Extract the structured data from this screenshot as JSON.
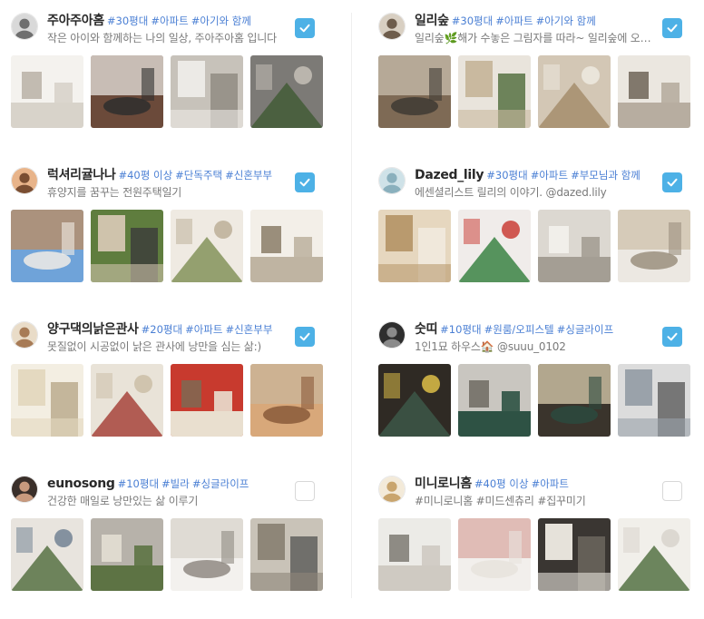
{
  "columns": [
    [
      {
        "name": "주아주아홈",
        "tags": [
          "#30평대",
          "#아파트",
          "#아기와 함께"
        ],
        "desc": "작은 아이와 함께하는 나의 일상, 주아주아홈 입니다",
        "checked": true,
        "avatar": [
          "#d9d9d9",
          "#6f6f6f"
        ],
        "photos": [
          [
            "#f4f2ee",
            "#d8d3ca",
            "#b9b2a6"
          ],
          [
            "#6b4a3a",
            "#f0eeea",
            "#2e2e2e"
          ],
          [
            "#c7c2ba",
            "#eceae6",
            "#8d8880"
          ],
          [
            "#7c7a76",
            "#3f5a33",
            "#c9c4bc"
          ]
        ]
      },
      {
        "name": "럭셔리귤나나",
        "tags": [
          "#40평 이상",
          "#단독주택",
          "#신혼부부"
        ],
        "desc": "휴양지를 꿈꾸는 전원주택일기",
        "checked": true,
        "avatar": [
          "#e8b48a",
          "#7a4e32"
        ],
        "photos": [
          [
            "#6fa3d9",
            "#c58a55",
            "#f1ece5"
          ],
          [
            "#5f7d3e",
            "#cfc3ac",
            "#3b3b3b"
          ],
          [
            "#efeae2",
            "#7d8d52",
            "#b9ab94"
          ],
          [
            "#f3efe8",
            "#bfb4a2",
            "#8a7c67"
          ]
        ]
      },
      {
        "name": "양구댁의낡은관사",
        "tags": [
          "#20평대",
          "#아파트",
          "#신혼부부"
        ],
        "desc": "못질없이 시공없이 낡은 관사에 낭만을 심는 삶:)",
        "checked": true,
        "avatar": [
          "#e9dcc8",
          "#a77b56"
        ],
        "photos": [
          [
            "#f3eee2",
            "#e4d9c0",
            "#b8a78a"
          ],
          [
            "#e9e3d8",
            "#a33a32",
            "#c9bba4"
          ],
          [
            "#c83a2e",
            "#e9dfcf",
            "#7e6a52"
          ],
          [
            "#d8a87a",
            "#c9b79c",
            "#8a5a3a"
          ]
        ]
      },
      {
        "name": "eunosong",
        "tags": [
          "#10평대",
          "#빌라",
          "#싱글라이프"
        ],
        "desc": "건강한 매일로 낭만있는 삶 이루기",
        "checked": false,
        "avatar": [
          "#3a2f2a",
          "#c89a7e"
        ],
        "photos": [
          [
            "#e8e4de",
            "#4e6a3a",
            "#6a7c8e"
          ],
          [
            "#b7b2aa",
            "#5d7344",
            "#e6e0d6"
          ],
          [
            "#f3f1ee",
            "#d6d1c9",
            "#8f8a82"
          ],
          [
            "#c9c3b8",
            "#8e8678",
            "#5a5a58"
          ]
        ]
      }
    ],
    [
      {
        "name": "일리숲",
        "tags": [
          "#30평대",
          "#아파트",
          "#아기와 함께"
        ],
        "desc": "일리숲🌿해가 수놓은 그림자를 따라~ 일리숲에 오신걸 환영해요",
        "checked": true,
        "avatar": [
          "#d8cfc2",
          "#6e5d4c"
        ],
        "photos": [
          [
            "#7e6a55",
            "#cfc4b4",
            "#3e3a34"
          ],
          [
            "#e9e4dc",
            "#c9b99f",
            "#4d6a3a"
          ],
          [
            "#d3c7b5",
            "#a38a68",
            "#f0ece4"
          ],
          [
            "#ebe7e0",
            "#b7ada0",
            "#6f6457"
          ]
        ]
      },
      {
        "name": "Dazed_lily",
        "tags": [
          "#30평대",
          "#아파트",
          "#부모님과 함께"
        ],
        "desc": "에센셜리스트 릴리의 이야기. @dazed.lily",
        "checked": true,
        "avatar": [
          "#cfe2e8",
          "#8ab0bd"
        ],
        "photos": [
          [
            "#e6d7bf",
            "#b99a6e",
            "#f2ece2"
          ],
          [
            "#f0ecea",
            "#2f7d3a",
            "#c8332c"
          ],
          [
            "#dcd8d1",
            "#a49e94",
            "#f5f3ef"
          ],
          [
            "#ece8e2",
            "#cdbfa8",
            "#9b8f7e"
          ]
        ]
      },
      {
        "name": "숫띠",
        "tags": [
          "#10평대",
          "#원룸/오피스텔",
          "#싱글라이프"
        ],
        "desc": "1인1묘 하우스🏠 @suuu_0102",
        "checked": true,
        "avatar": [
          "#2e2e2e",
          "#8a8a8a"
        ],
        "photos": [
          [
            "#2f2a24",
            "#3d5a4a",
            "#e9c84a"
          ],
          [
            "#c9c6c0",
            "#2e5244",
            "#6f6a62"
          ],
          [
            "#3a342c",
            "#e6d8b8",
            "#2c4a3e"
          ],
          [
            "#dcdcdc",
            "#9aa2aa",
            "#5c5c5c"
          ]
        ]
      },
      {
        "name": "미니로니홈",
        "tags": [
          "#40평 이상",
          "#아파트"
        ],
        "desc": "#미니로니홈 #미드센츄리 #집꾸미기",
        "checked": false,
        "avatar": [
          "#f3ead9",
          "#c9a56e"
        ],
        "photos": [
          [
            "#ecebe7",
            "#cfcac2",
            "#7e7a72"
          ],
          [
            "#f2efec",
            "#d9a7a0",
            "#e7e3dd"
          ],
          [
            "#3a3632",
            "#e6e2da",
            "#6f6a60"
          ],
          [
            "#f1efea",
            "#4b6a3a",
            "#d7d2ca"
          ]
        ]
      }
    ]
  ]
}
